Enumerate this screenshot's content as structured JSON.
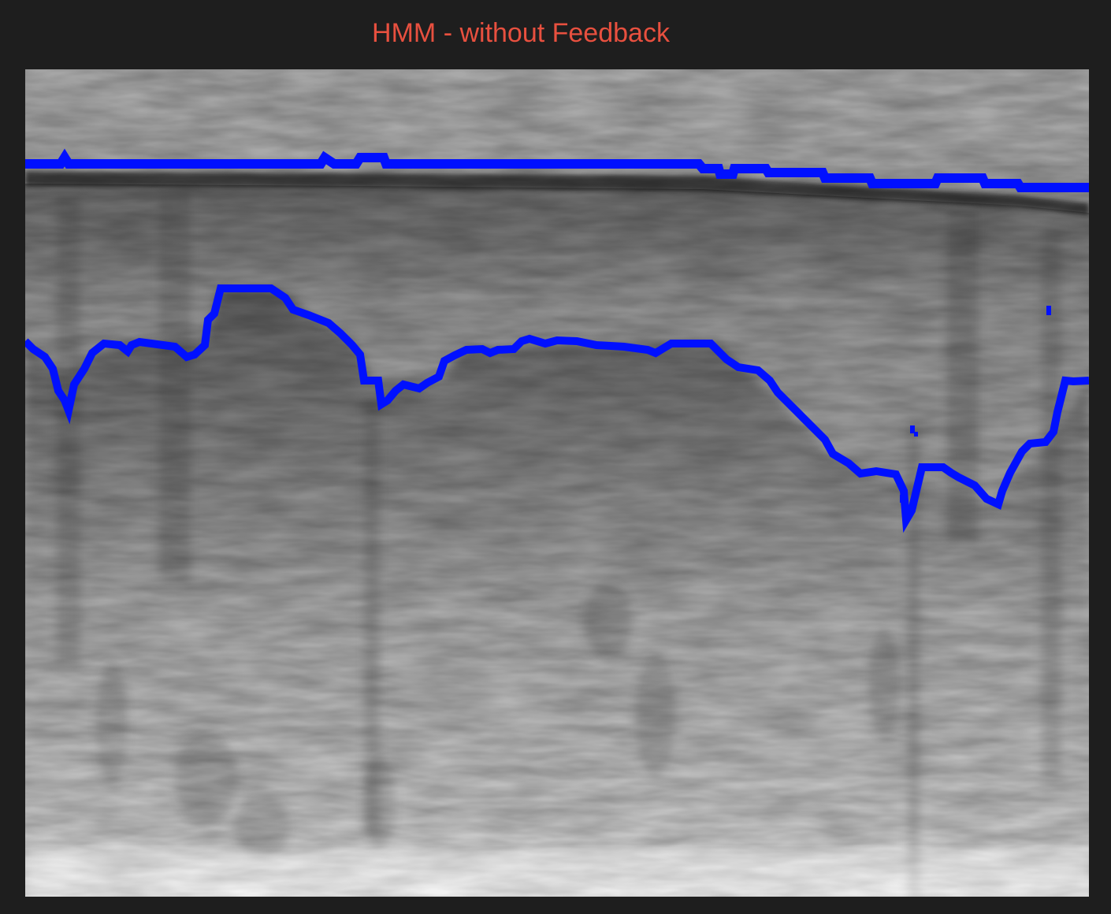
{
  "title": "HMM - without Feedback",
  "colors": {
    "background": "#1e1e1e",
    "title": "#e8503f",
    "trace": "#0010ff"
  }
}
